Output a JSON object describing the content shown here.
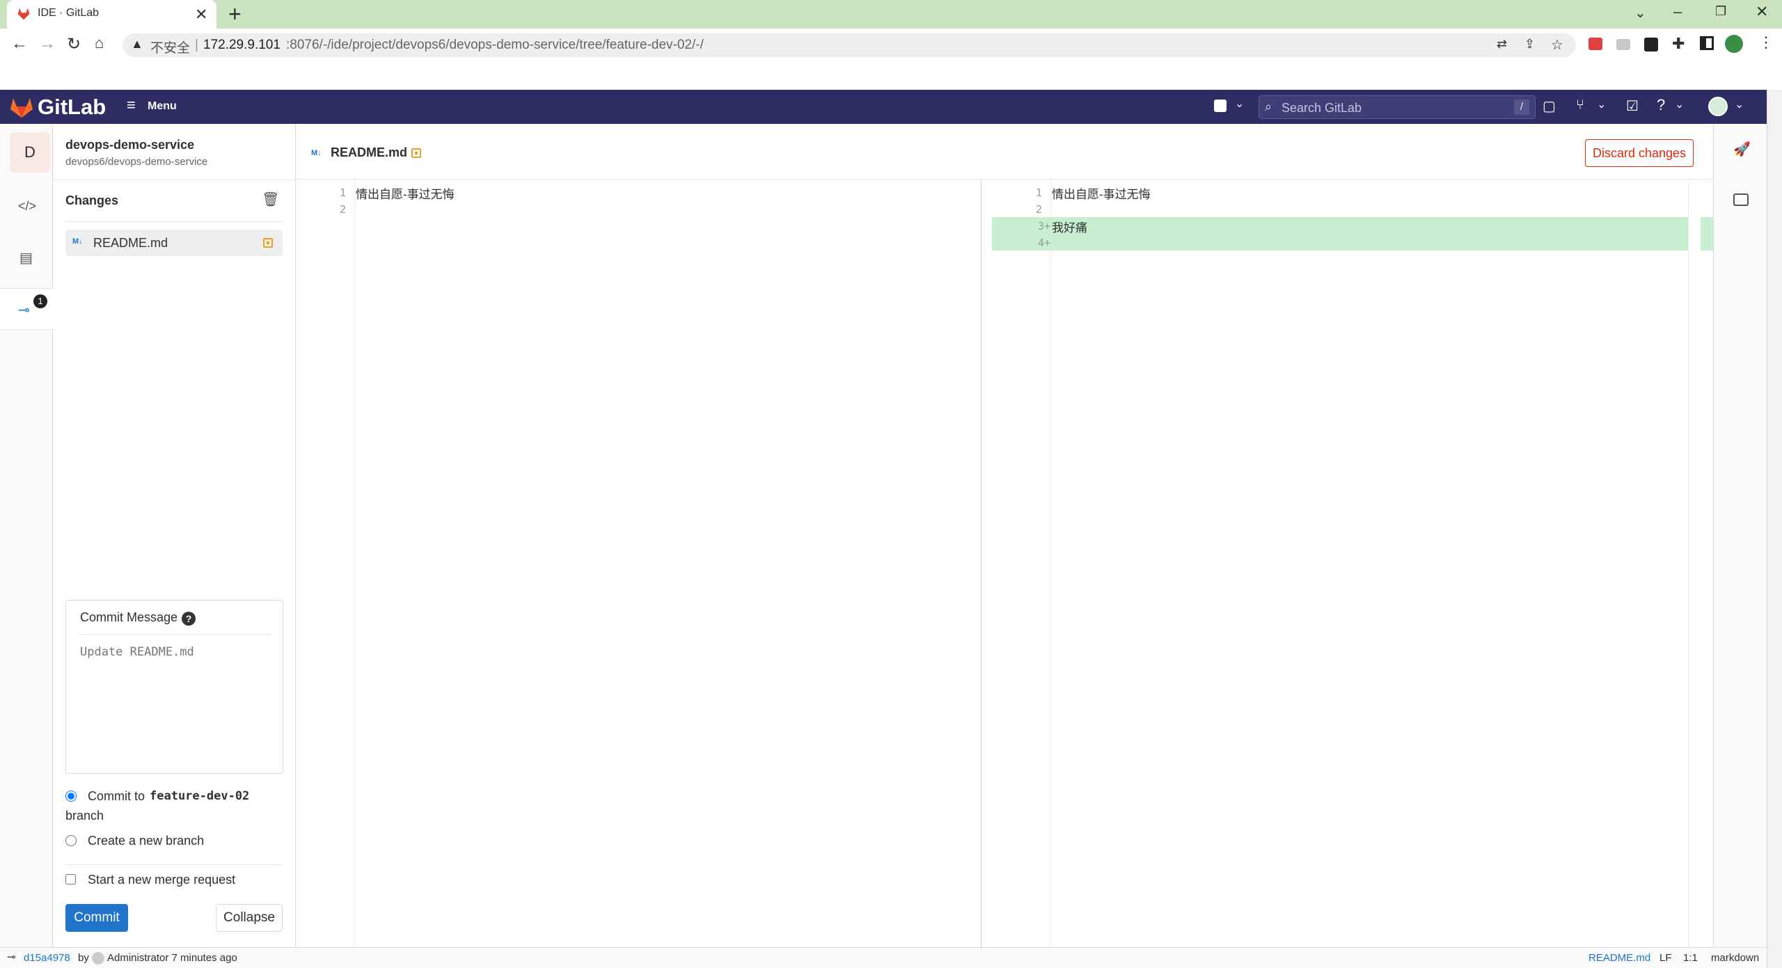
{
  "browser": {
    "tab_title": "IDE · GitLab",
    "new_tab": "+",
    "insecure_label": "不安全",
    "url_host": "172.29.9.101",
    "url_rest": ":8076/-/ide/project/devops6/devops-demo-service/tree/feature-dev-02/-/"
  },
  "nav": {
    "logo_text": "GitLab",
    "menu_label": "Menu",
    "search_placeholder": "Search GitLab",
    "search_shortcut": "/"
  },
  "project": {
    "avatar_letter": "D",
    "name": "devops-demo-service",
    "path": "devops6/devops-demo-service"
  },
  "activity": {
    "commit_badge": "1"
  },
  "changes": {
    "title": "Changes",
    "files": [
      {
        "icon": "M↓",
        "name": "README.md"
      }
    ]
  },
  "commit_form": {
    "label": "Commit Message",
    "help": "?",
    "placeholder": "Update README.md",
    "option_current_prefix": "Commit to",
    "branch": "feature-dev-02",
    "option_current_suffix": "branch",
    "option_new": "Create a new branch",
    "merge_request": "Start a new merge request",
    "commit_button": "Commit",
    "collapse_button": "Collapse"
  },
  "editor": {
    "file_icon": "M↓",
    "file_name": "README.md",
    "discard_button": "Discard changes",
    "left": [
      {
        "n": "1",
        "text": "情出自愿-事过无悔"
      },
      {
        "n": "2",
        "text": ""
      }
    ],
    "right": [
      {
        "n": "1",
        "text": "情出自愿-事过无悔",
        "added": false
      },
      {
        "n": "2",
        "text": "",
        "added": false
      },
      {
        "n": "3+",
        "text": "我好痛",
        "added": true
      },
      {
        "n": "4+",
        "text": "",
        "added": true
      }
    ]
  },
  "status": {
    "commit_sha": "d15a4978",
    "by": "by",
    "author_time": "Administrator 7 minutes ago",
    "file": "README.md",
    "eol": "LF",
    "position": "1:1",
    "language": "markdown"
  },
  "colors": {
    "nav_bg": "#2d2c63",
    "primary": "#1f75cb",
    "danger": "#dd2b0e",
    "added_bg": "#c8f0d0",
    "modified": "#e9a023"
  }
}
